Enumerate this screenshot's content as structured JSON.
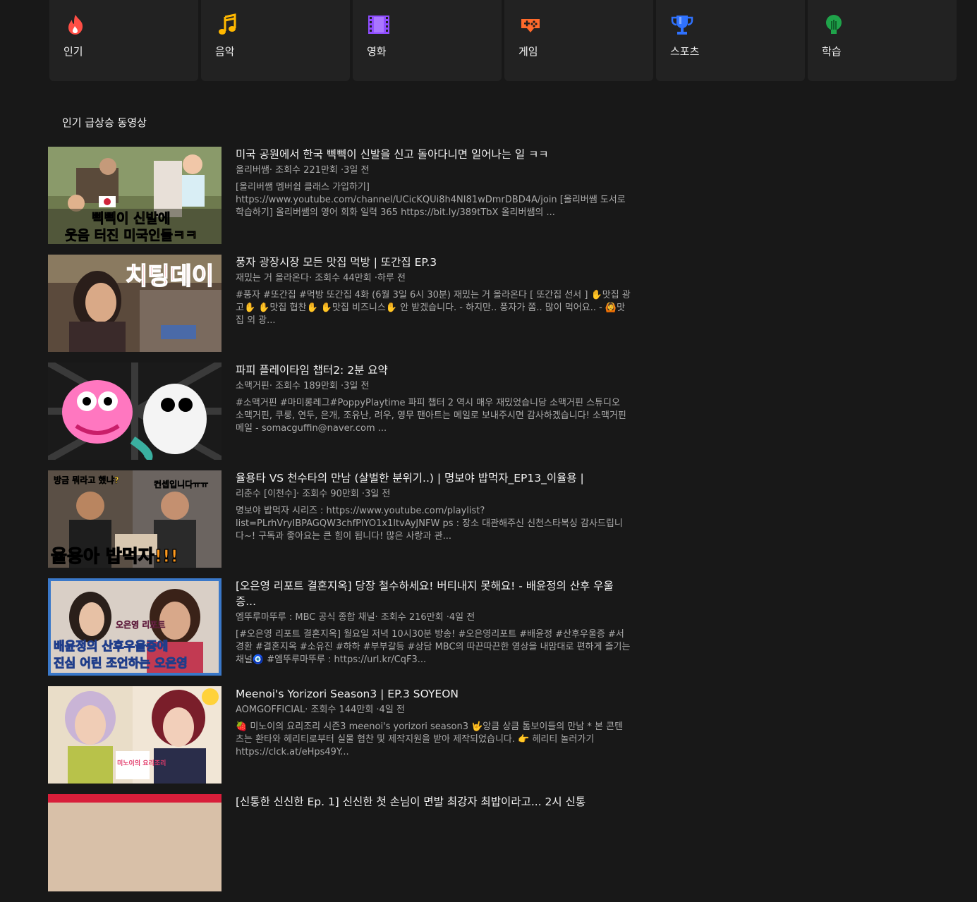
{
  "categories": [
    {
      "label": "인기",
      "icon": "flame-icon",
      "color": "#ff4e45"
    },
    {
      "label": "음악",
      "icon": "music-note-icon",
      "color": "#ffb800"
    },
    {
      "label": "영화",
      "icon": "film-icon",
      "color": "#8f4dff"
    },
    {
      "label": "게임",
      "icon": "gamepad-icon",
      "color": "#ff6a2b"
    },
    {
      "label": "스포츠",
      "icon": "trophy-icon",
      "color": "#2f72ff"
    },
    {
      "label": "학습",
      "icon": "lightbulb-icon",
      "color": "#1fa34a"
    }
  ],
  "section": {
    "title": "인기 급상승 동영상"
  },
  "videos": [
    {
      "title": "미국 공원에서 한국 삑삑이 신발을 신고 돌아다니면 일어나는 일 ㅋㅋ",
      "channel": "올리버쌤",
      "views": "조회수 221만회",
      "age": "3일 전",
      "desc": "[올리버쌤 멤버쉽 클래스 가입하기] https://www.youtube.com/channel/UCicKQUi8h4NI81wDmrDBD4A/join [올리버쌤 도서로 학습하기] 올리버쌤의 영어 회화 일력 365 https://bit.ly/389tTbX 올리버쌤의 ...",
      "thumb_text": [
        "삑삑이 신발에",
        "웃음 터진 미국인들ㅋㅋ"
      ]
    },
    {
      "title": "풍자 광장시장 모든 맛집 먹방 | 또간집 EP.3",
      "channel": "재밌는 거 올라온다",
      "views": "조회수 44만회",
      "age": "하루 전",
      "desc": "#풍자 #또간집 #먹방 또간집 4화 (6월 3일 6시 30분) 재밌는 거 올라온다 [ 또간집 선서 ] ✋맛집 광고✋ ✋맛집 협찬✋ ✋맛집 비즈니스✋ 안 받겠습니다. - 하지만.. 풍자가 쫌.. 많이 먹어요.. - 🙆맛집 외 광...",
      "thumb_text": [
        "치팅데이"
      ]
    },
    {
      "title": "파피 플레이타임 챕터2: 2분 요약",
      "channel": "소맥거핀",
      "views": "조회수 189만회",
      "age": "3일 전",
      "desc": "#소맥거핀 #마미롱레그#PoppyPlaytime 파피 챕터 2 역시 매우 재밌었습니당 소맥거핀 스튜디오 소맥거핀, 쿠룽, 연두, 은개, 조유난, 려우, 영무 팬아트는 메일로 보내주시면 감사하겠습니다! 소맥거핀 메일 - somacguffin@naver.com ...",
      "thumb_text": []
    },
    {
      "title": "율용타 VS 천수타의 만남 (살벌한 분위기..) | 명보야 밥먹자_EP13_이율용 |",
      "channel": "리춘수 [이천수]",
      "views": "조회수 90만회",
      "age": "3일 전",
      "desc": "명보야 밥먹자 시리즈 : https://www.youtube.com/playlist?list=PLrhVryIBPAGQW3chfPlYO1x1ltvAyJNFW ps : 장소 대관해주신 신천스타복싱 감사드립니다~! 구독과 좋아요는 큰 힘이 됩니다! 많은 사랑과 관...",
      "thumb_text": [
        "방금 뭐라고 했냐?",
        "컨셉입니다ㅠㅠ",
        "율용아 밥먹자!!!"
      ]
    },
    {
      "title": "[오은영 리포트 결혼지옥] 당장 철수하세요! 버티내지 못해요! - 배윤정의 산후 우울증...",
      "channel": "엠뚜루마뚜루 : MBC 공식 종합 채널",
      "views": "조회수 216만회",
      "age": "4일 전",
      "desc": "[#오은영 리포트 결혼지옥] 월요일 저녁 10시30분 방송! #오은영리포트 #배윤정 #산후우울증 #서경환 #결혼지옥 #소유진 #하하 #부부갈등 #상담 MBC의 따끈따끈한 영상을 내맘대로 편하게 즐기는 채널🧿 #엠뚜루마뚜루 : https://url.kr/CqF3...",
      "thumb_text": [
        "배윤정의 산후우울증에",
        "진심 어린 조언하는 오은영",
        "오은영 리포트"
      ]
    },
    {
      "title": "Meenoi's Yorizori Season3 | EP.3 SOYEON",
      "channel": "AOMGOFFICIAL",
      "views": "조회수 144만회",
      "age": "4일 전",
      "desc": "🍓 미노이의 요리조리 시즌3 meenoi's yorizori season3 🤟앙큼 상큼 톰보이들의 만남 * 본 콘텐츠는 환타와 헤리티로부터 실물 협찬 및 제작지원을 받아 제작되었습니다. 👉 헤리티 놀러가기 https://clck.at/eHps49Y...",
      "thumb_text": [
        "미노이의 요리조리"
      ]
    },
    {
      "title": "[신통한 신신한 Ep. 1] 신신한 첫 손님이 면발 최강자 최밥이라고... 2시 신통",
      "channel": "",
      "views": "",
      "age": "",
      "desc": "",
      "thumb_text": []
    }
  ]
}
